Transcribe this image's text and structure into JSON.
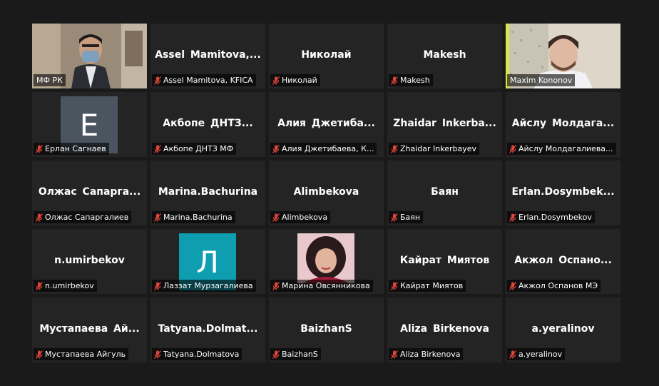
{
  "participants": [
    {
      "big": "",
      "tag": "МФ РК",
      "muted": false,
      "video": "video-man-mask"
    },
    {
      "big": "Assel Mamitova,...",
      "tag": "Assel Mamitova, KFICA",
      "muted": true
    },
    {
      "big": "Николай",
      "tag": "Николай",
      "muted": true
    },
    {
      "big": "Makesh",
      "tag": "Makesh",
      "muted": true
    },
    {
      "big": "",
      "tag": "Maxim Kononov",
      "muted": false,
      "video": "video-man",
      "active": true
    },
    {
      "big": "",
      "tag": "Ерлан Сагнаев",
      "muted": true,
      "letter": "E",
      "letter_color": "#4a5560"
    },
    {
      "big": "Акбопе ДНТЗ...",
      "tag": "Акбопе ДНТЗ МФ",
      "muted": true
    },
    {
      "big": "Алия Джетиба...",
      "tag": "Алия Джетибаева, К...",
      "muted": true
    },
    {
      "big": "Zhaidar Inkerba...",
      "tag": "Zhaidar Inkerbayev",
      "muted": true
    },
    {
      "big": "Айслу Молдага...",
      "tag": "Айслу Молдагалиева...",
      "muted": true
    },
    {
      "big": "Олжас Сапарга...",
      "tag": "Олжас Сапаргалиев",
      "muted": true
    },
    {
      "big": "Marina.Bachurina",
      "tag": "Marina.Bachurina",
      "muted": true
    },
    {
      "big": "Alimbekova",
      "tag": "Alimbekova",
      "muted": true
    },
    {
      "big": "Баян",
      "tag": "Баян",
      "muted": true
    },
    {
      "big": "Erlan.Dosymbek...",
      "tag": "Erlan.Dosymbekov",
      "muted": true
    },
    {
      "big": "n.umirbekov",
      "tag": "n.umirbekov",
      "muted": true
    },
    {
      "big": "",
      "tag": "Лаззат Мурзагалиева",
      "muted": true,
      "letter": "Л",
      "letter_color": "#0f9eb0"
    },
    {
      "big": "",
      "tag": "Марина Овсянникова",
      "muted": true,
      "photo": "photo-woman"
    },
    {
      "big": "Кайрат Миятов",
      "tag": "Кайрат Миятов",
      "muted": true
    },
    {
      "big": "Акжол Оспано...",
      "tag": "Акжол Оспанов МЭ",
      "muted": true
    },
    {
      "big": "Мустапаева Ай...",
      "tag": "Мустапаева Айгуль",
      "muted": true
    },
    {
      "big": "Tatyana.Dolmat...",
      "tag": "Tatyana.Dolmatova",
      "muted": true
    },
    {
      "big": "BaizhanS",
      "tag": "BaizhanS",
      "muted": true
    },
    {
      "big": "Aliza Birkenova",
      "tag": "Aliza Birkenova",
      "muted": true
    },
    {
      "big": "a.yeralinov",
      "tag": "a.yeralinov",
      "muted": true
    }
  ],
  "colors": {
    "active_border": "#d9e64a",
    "mute_red": "#e0443a",
    "tile_bg": "#242424",
    "bg": "#1a1a1a"
  }
}
